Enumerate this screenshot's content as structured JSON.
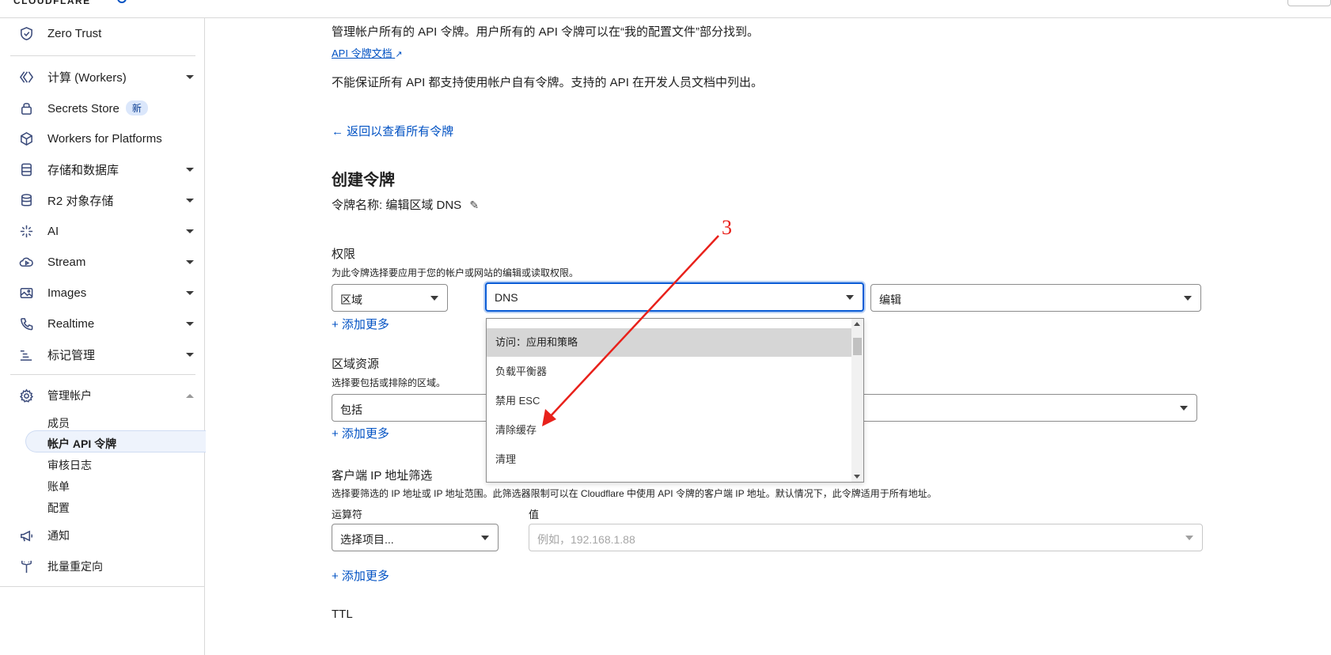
{
  "topbar": {
    "brand": "CLOUDFLARE"
  },
  "sidebar": {
    "items": [
      {
        "label": "Zero Trust",
        "icon": "zero-trust-icon"
      },
      {
        "label": "计算 (Workers)",
        "icon": "workers-icon",
        "caret": true
      },
      {
        "label": "Secrets Store",
        "icon": "lock-icon",
        "badge": "新"
      },
      {
        "label": "Workers for Platforms",
        "icon": "cube-icon"
      },
      {
        "label": "存储和数据库",
        "icon": "database-icon",
        "caret": true
      },
      {
        "label": "R2 对象存储",
        "icon": "storage-icon",
        "caret": true
      },
      {
        "label": "AI",
        "icon": "sparkle-icon",
        "caret": true
      },
      {
        "label": "Stream",
        "icon": "stream-icon",
        "caret": true
      },
      {
        "label": "Images",
        "icon": "image-icon",
        "caret": true
      },
      {
        "label": "Realtime",
        "icon": "phone-icon",
        "caret": true
      },
      {
        "label": "标记管理",
        "icon": "tag-list-icon",
        "caret": true
      },
      {
        "label": "管理帐户",
        "icon": "gear-icon",
        "caret_up": true
      },
      {
        "label": "通知",
        "icon": "megaphone-icon"
      },
      {
        "label": "批量重定向",
        "icon": "redirect-icon"
      }
    ],
    "account_sub": [
      "成员",
      "帐户 API 令牌",
      "审核日志",
      "账单",
      "配置"
    ]
  },
  "main": {
    "intro": "管理帐户所有的 API 令牌。用户所有的 API 令牌可以在“我的配置文件”部分找到。",
    "docs_link": "API 令牌文档",
    "note": "不能保证所有 API 都支持使用帐户自有令牌。支持的 API 在开发人员文档中列出。",
    "back_link": "← 返回以查看所有令牌",
    "heading": "创建令牌",
    "token_name": "令牌名称: 编辑区域 DNS",
    "permissions": {
      "title": "权限",
      "desc": "为此令牌选择要应用于您的帐户或网站的编辑或读取权限。",
      "scope": "区域",
      "resource": "DNS",
      "level": "编辑",
      "add_more": "+ 添加更多"
    },
    "dropdown_options": [
      "访问：应用和策略",
      "负载平衡器",
      "禁用 ESC",
      "清除缓存",
      "清理"
    ],
    "zone_resources": {
      "title": "区域资源",
      "desc": "选择要包括或排除的区域。",
      "include": "包括",
      "add_more": "+ 添加更多"
    },
    "ip_filter": {
      "title": "客户端 IP 地址筛选",
      "desc": "选择要筛选的 IP 地址或 IP 地址范围。此筛选器限制可以在 Cloudflare 中使用 API 令牌的客户端 IP 地址。默认情况下，此令牌适用于所有地址。",
      "operator_label": "运算符",
      "value_label": "值",
      "operator_placeholder": "选择项目...",
      "value_placeholder": "例如，192.168.1.88",
      "add_more": "+ 添加更多"
    },
    "ttl": "TTL"
  },
  "annotation": {
    "label": "3",
    "color": "#e8211b"
  },
  "colors": {
    "link": "#0051c3",
    "accent": "#0a5cd6",
    "annotation": "#e8211b"
  }
}
